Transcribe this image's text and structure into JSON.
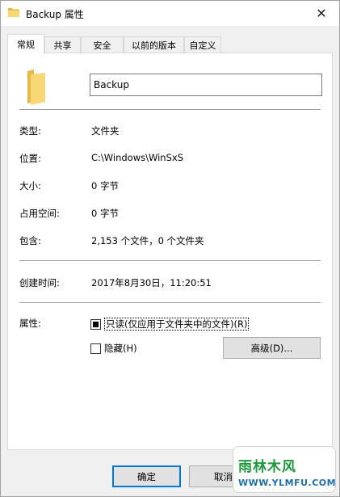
{
  "window": {
    "title": "Backup 属性"
  },
  "tabs": [
    {
      "label": "常规",
      "active": true
    },
    {
      "label": "共享",
      "active": false
    },
    {
      "label": "安全",
      "active": false
    },
    {
      "label": "以前的版本",
      "active": false
    },
    {
      "label": "自定义",
      "active": false
    }
  ],
  "general": {
    "name_value": "Backup",
    "type_label": "类型:",
    "type_value": "文件夹",
    "location_label": "位置:",
    "location_value": "C:\\Windows\\WinSxS",
    "size_label": "大小:",
    "size_value": "0 字节",
    "size_on_disk_label": "占用空间:",
    "size_on_disk_value": "0 字节",
    "contains_label": "包含:",
    "contains_value": "2,153 个文件，0 个文件夹",
    "created_label": "创建时间:",
    "created_value": "2017年8月30日，11:20:51",
    "attributes_label": "属性:",
    "readonly_label": "只读(仅应用于文件夹中的文件)(R)",
    "readonly_state": "indeterminate",
    "hidden_label": "隐藏(H)",
    "hidden_state": "unchecked",
    "advanced_label": "高级(D)..."
  },
  "buttons": {
    "ok_label": "确定",
    "cancel_label": "取消"
  },
  "watermark": {
    "line1": "雨林木风",
    "line2": "WWW.YLMFU.COM"
  },
  "colors": {
    "folder": "#f8d775",
    "folder_dark": "#e8b84a",
    "accent": "#0078d7"
  },
  "icons": {
    "folder": "folder-icon",
    "close": "close-icon"
  }
}
